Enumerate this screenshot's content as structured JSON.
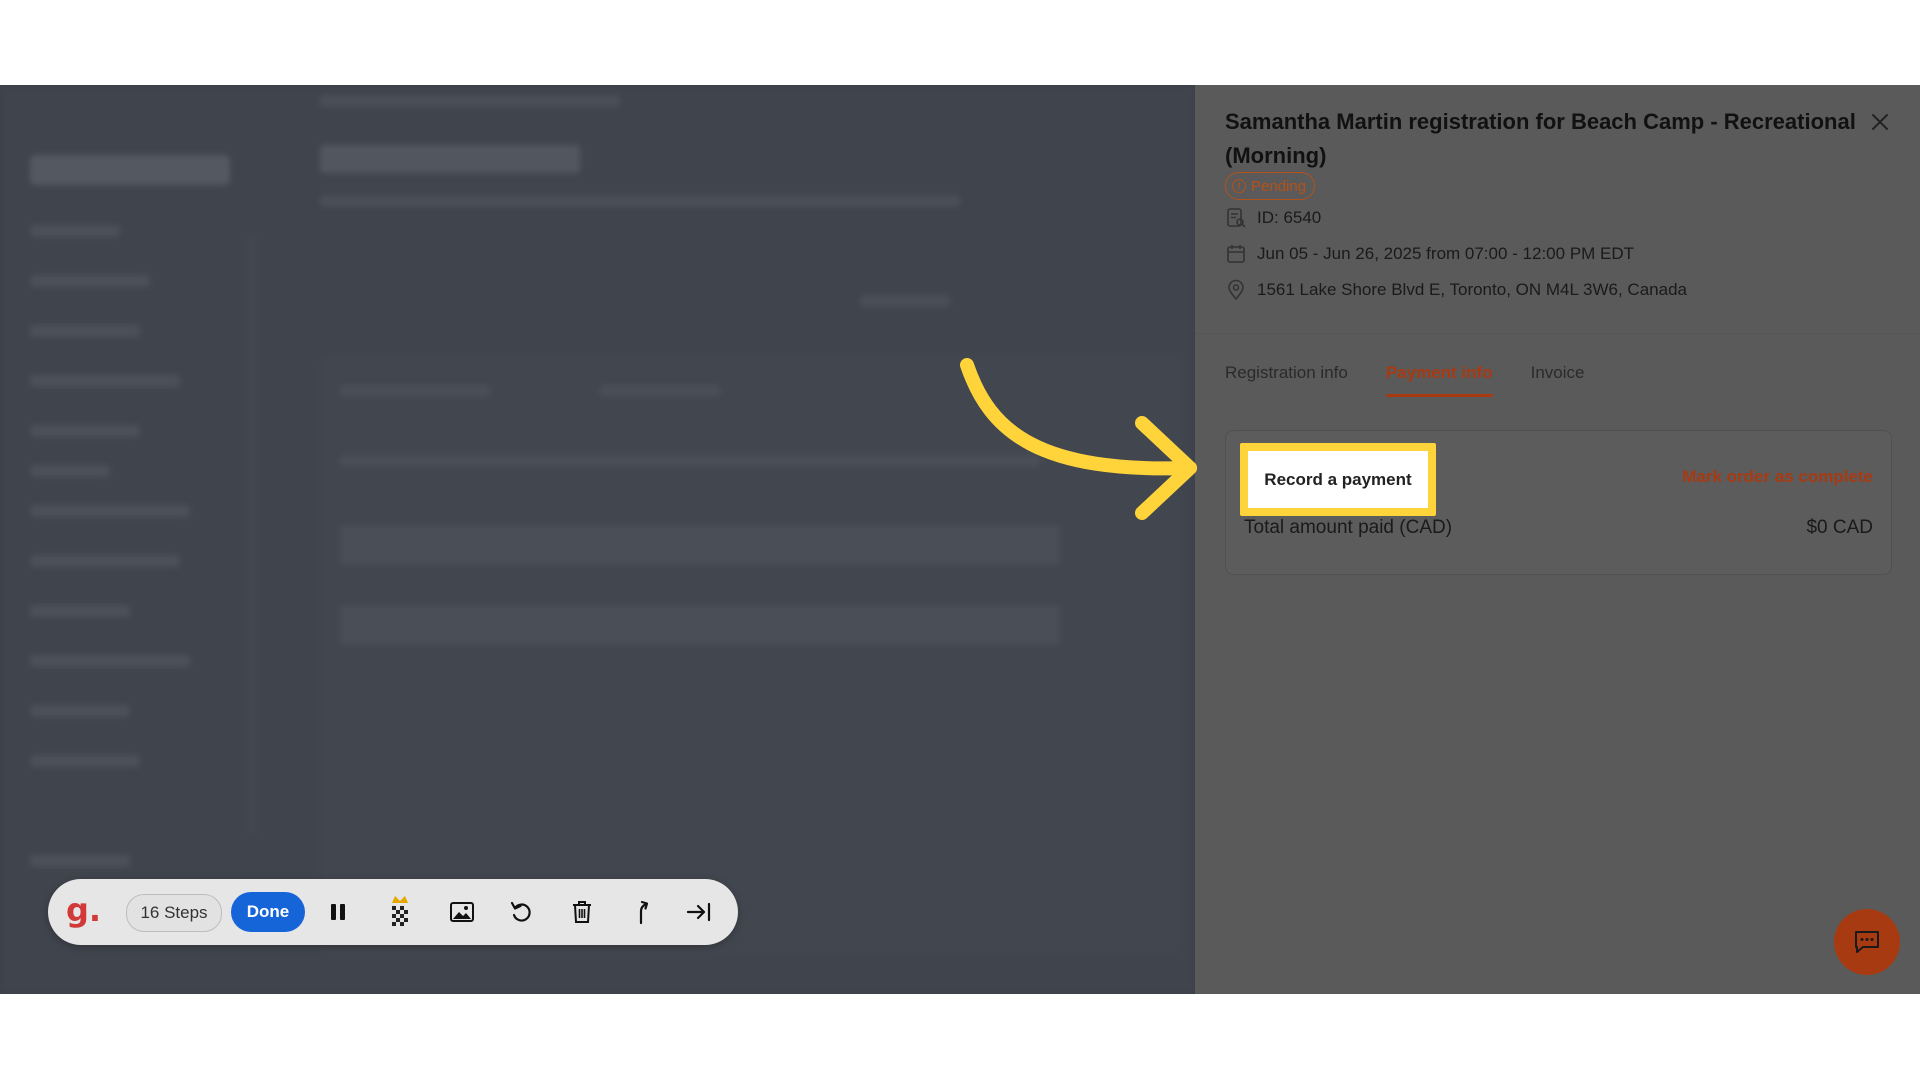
{
  "drawer": {
    "title": "Samantha Martin registration for Beach Camp - Recreational (Morning)",
    "status": "Pending",
    "id_text": "ID: 6540",
    "dates_text": "Jun 05 - Jun 26, 2025 from 07:00 - 12:00 PM EDT",
    "address_text": "1561 Lake Shore Blvd E, Toronto, ON M4L 3W6, Canada",
    "tabs": [
      {
        "label": "Registration info",
        "active": false
      },
      {
        "label": "Payment info",
        "active": true
      },
      {
        "label": "Invoice",
        "active": false
      }
    ],
    "payment": {
      "record_button": "Record a payment",
      "mark_complete": "Mark order as complete",
      "total_label": "Total amount paid (CAD)",
      "total_value": "$0 CAD"
    }
  },
  "toolbar": {
    "logo": "g.",
    "steps_label": "16 Steps",
    "done_label": "Done",
    "icons": [
      "pause-icon",
      "blur-icon",
      "image-icon",
      "undo-icon",
      "trash-icon",
      "branch-icon",
      "skip-to-end-icon"
    ]
  },
  "colors": {
    "accent": "#a83a12",
    "highlight": "#ffd43b",
    "done_button": "#1565d8",
    "overlay": "#3a3e46"
  }
}
